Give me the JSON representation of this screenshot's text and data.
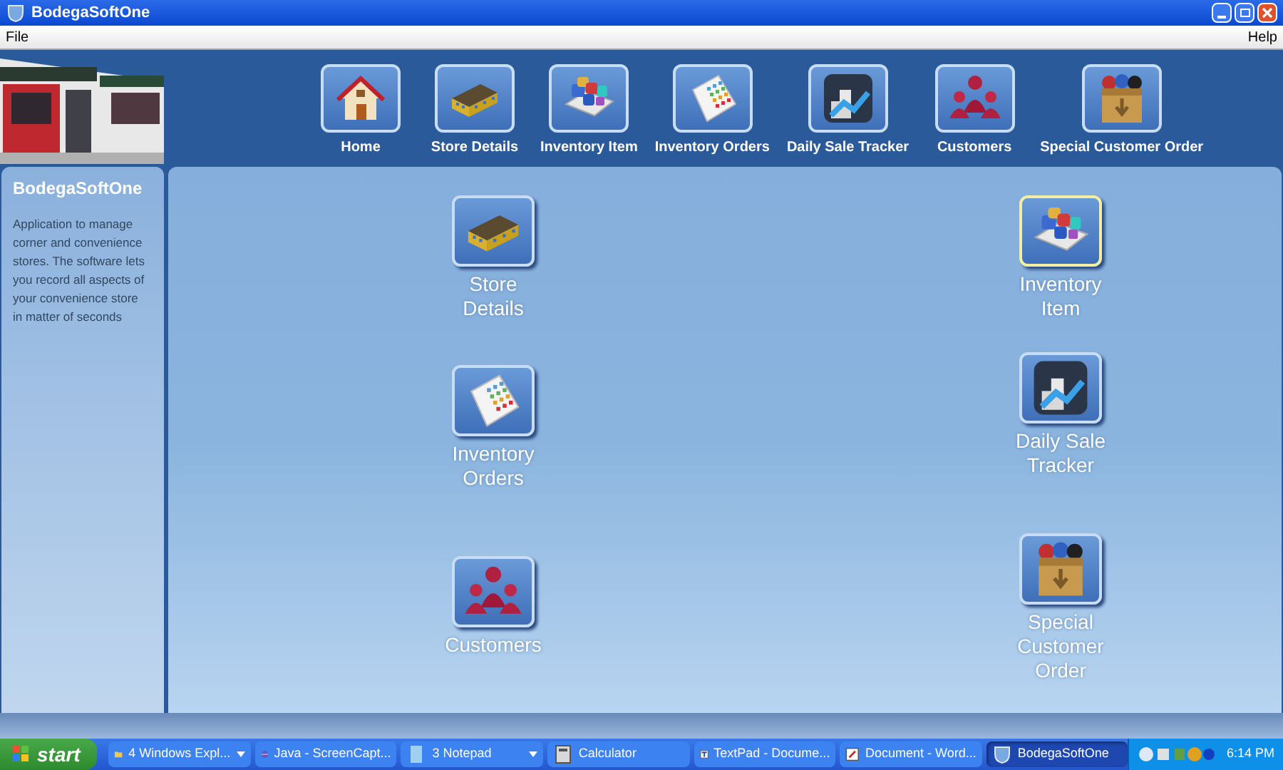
{
  "window": {
    "title": "BodegaSoftOne"
  },
  "menu": [
    "File",
    "Help"
  ],
  "toolbar": [
    {
      "kind": "home",
      "label": "Home"
    },
    {
      "kind": "store",
      "label": "Store Details"
    },
    {
      "kind": "inventory",
      "label": "Inventory Item"
    },
    {
      "kind": "orders",
      "label": "Inventory Orders"
    },
    {
      "kind": "tracker",
      "label": "Daily Sale Tracker"
    },
    {
      "kind": "customers",
      "label": "Customers"
    },
    {
      "kind": "special",
      "label": "Special Customer Order"
    }
  ],
  "sidebar": {
    "title": "BodegaSoftOne",
    "description": "Application to manage corner and convenience stores.  The software lets you record all aspects of your convenience store in matter of seconds"
  },
  "tiles_left": [
    {
      "kind": "store",
      "label": "Store Details",
      "selected": false
    },
    {
      "kind": "orders",
      "label": "Inventory Orders",
      "selected": false
    },
    {
      "kind": "customers",
      "label": "Customers",
      "selected": false
    }
  ],
  "tiles_right": [
    {
      "kind": "inventory",
      "label": "Inventory Item",
      "selected": true
    },
    {
      "kind": "tracker",
      "label": "Daily Sale Tracker",
      "selected": false
    },
    {
      "kind": "special",
      "label": "Special Customer Order",
      "selected": false
    }
  ],
  "taskbar": {
    "start": "start",
    "tasks": [
      {
        "kind": "folder",
        "label": "4 Windows Expl...",
        "grouped": true,
        "selected": false
      },
      {
        "kind": "java",
        "label": "Java - ScreenCapt...",
        "grouped": false,
        "selected": false
      },
      {
        "kind": "notepad",
        "label": "3 Notepad",
        "grouped": true,
        "selected": false
      },
      {
        "kind": "calculator",
        "label": "Calculator",
        "grouped": false,
        "selected": false
      },
      {
        "kind": "textpad",
        "label": "TextPad - Docume...",
        "grouped": false,
        "selected": false
      },
      {
        "kind": "word",
        "label": "Document - Word...",
        "grouped": false,
        "selected": false
      },
      {
        "kind": "app",
        "label": "BodegaSoftOne",
        "grouped": false,
        "selected": true
      }
    ],
    "clock": "6:14 PM"
  }
}
